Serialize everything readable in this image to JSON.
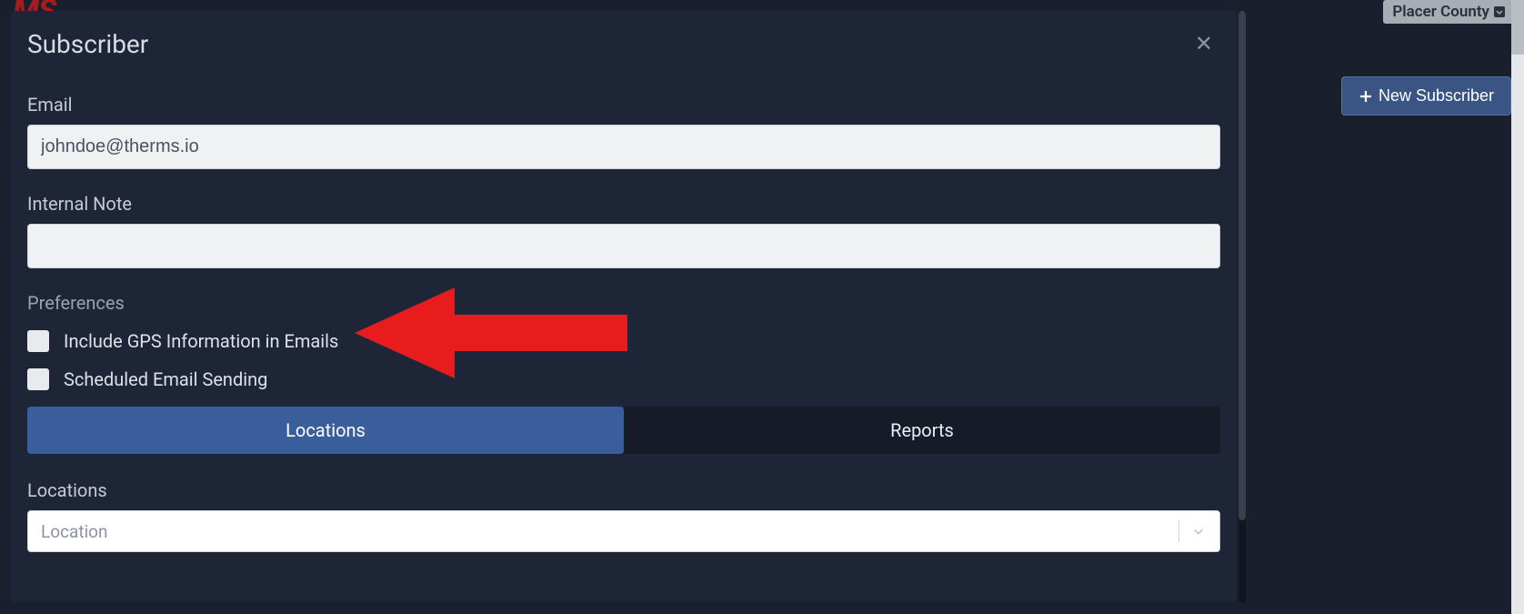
{
  "app": {
    "logo_text": "MS"
  },
  "header": {
    "badge_label": "Placer County"
  },
  "actions": {
    "new_subscriber_label": "New Subscriber"
  },
  "modal": {
    "title": "Subscriber",
    "email_label": "Email",
    "email_value": "johndoe@therms.io",
    "internal_note_label": "Internal Note",
    "internal_note_value": "",
    "preferences_label": "Preferences",
    "checkbox_gps_label": "Include GPS Information in Emails",
    "checkbox_scheduled_label": "Scheduled Email Sending",
    "tabs": {
      "locations": "Locations",
      "reports": "Reports"
    },
    "locations_label": "Locations",
    "location_placeholder": "Location"
  }
}
